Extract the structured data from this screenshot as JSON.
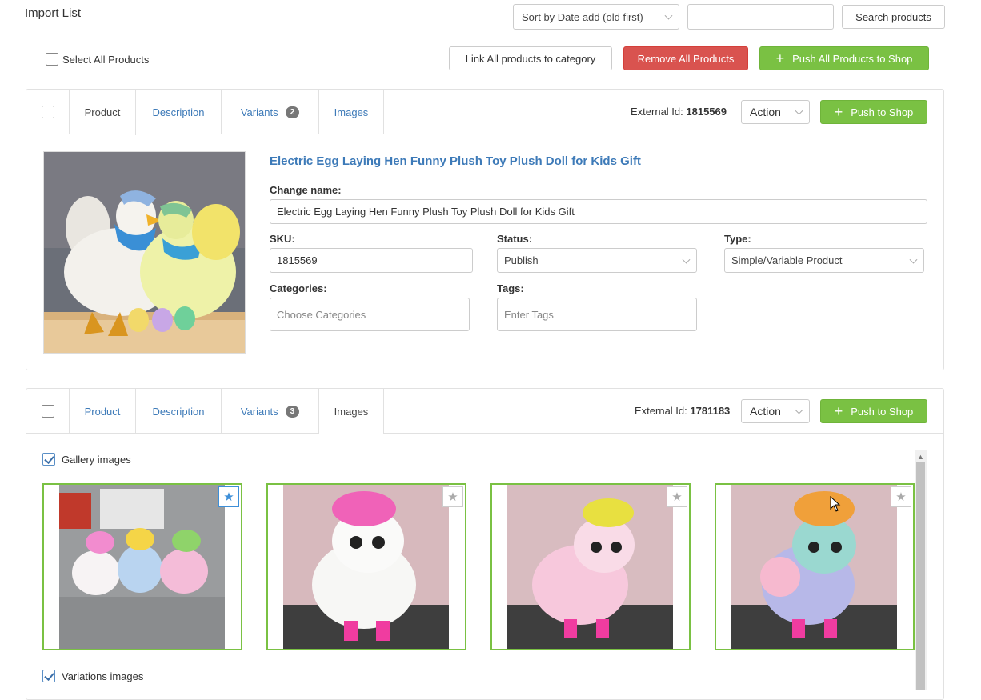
{
  "header": {
    "title": "Import List",
    "sort_value": "Sort by Date add (old first)",
    "search_value": "",
    "search_button": "Search products"
  },
  "bulk": {
    "select_all_label": "Select All Products",
    "link_all": "Link All products to category",
    "remove_all": "Remove All Products",
    "push_all": "Push All Products to Shop"
  },
  "products": [
    {
      "tabs": {
        "product": "Product",
        "description": "Description",
        "variants": "Variants",
        "variants_count": "2",
        "images": "Images"
      },
      "active_tab": "Product",
      "external_id_label": "External Id:",
      "external_id": "1815569",
      "action_label": "Action",
      "push_label": "Push to Shop",
      "image_icon": "chicken-plush-photo",
      "title": "Electric Egg Laying Hen Funny Plush Toy Plush Doll for Kids Gift",
      "change_name_label": "Change name:",
      "change_name_value": "Electric Egg Laying Hen Funny Plush Toy Plush Doll for Kids Gift",
      "sku_label": "SKU:",
      "sku_value": "1815569",
      "status_label": "Status:",
      "status_value": "Publish",
      "type_label": "Type:",
      "type_value": "Simple/Variable Product",
      "categories_label": "Categories:",
      "categories_placeholder": "Choose Categories",
      "tags_label": "Tags:",
      "tags_placeholder": "Enter Tags"
    },
    {
      "tabs": {
        "product": "Product",
        "description": "Description",
        "variants": "Variants",
        "variants_count": "3",
        "images": "Images"
      },
      "active_tab": "Images",
      "external_id_label": "External Id:",
      "external_id": "1781183",
      "action_label": "Action",
      "push_label": "Push to Shop",
      "gallery_label": "Gallery images",
      "gallery_checked": true,
      "variations_label": "Variations images",
      "variations_checked": true,
      "gallery": [
        {
          "icon": "alpaca-group-photo",
          "featured": true
        },
        {
          "icon": "white-alpaca-photo",
          "featured": false
        },
        {
          "icon": "pink-alpaca-photo",
          "featured": false
        },
        {
          "icon": "rainbow-alpaca-photo",
          "featured": false
        }
      ]
    }
  ],
  "colors": {
    "link": "#3d7ab8",
    "success": "#7ac143",
    "danger": "#d9534f",
    "badge": "#777777"
  }
}
